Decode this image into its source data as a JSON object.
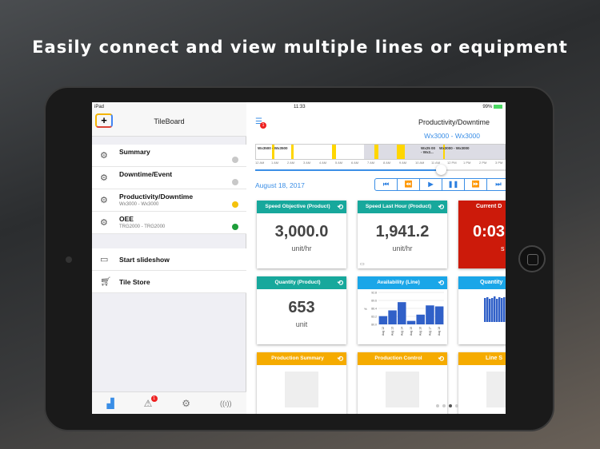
{
  "headline": "Easily connect and view multiple lines or equipment",
  "status": {
    "device": "iPad",
    "time": "11:33",
    "battery": "99%"
  },
  "sidebar": {
    "title": "TileBoard",
    "items": [
      {
        "label": "Summary",
        "sub": "",
        "status_color": "#c8c8c8"
      },
      {
        "label": "Downtime/Event",
        "sub": "",
        "status_color": "#c8c8c8"
      },
      {
        "label": "Productivity/Downtime",
        "sub": "Wx3000 - Wx3000",
        "status_color": "#f4c20d"
      },
      {
        "label": "OEE",
        "sub": "TRG2000 - TRG2000",
        "status_color": "#1e9e3a"
      }
    ],
    "actions": [
      {
        "label": "Start slideshow",
        "icon": "slideshow-icon"
      },
      {
        "label": "Tile Store",
        "icon": "cart-icon"
      }
    ],
    "tabs": [
      {
        "icon": "factory-icon",
        "active": true
      },
      {
        "icon": "alert-icon",
        "badge": "1"
      },
      {
        "icon": "gear-icon"
      },
      {
        "icon": "antenna-icon"
      }
    ]
  },
  "main": {
    "menu_badge": "1",
    "title": "Productivity/Downtime",
    "subtitle": "Wx3000 - Wx3000",
    "timeline": {
      "segments": [
        "Wx3500 - Wx3500",
        "Wx25 00 - Wx2...",
        "Wx3000 - Wx3000"
      ],
      "ticks": [
        "12 AM",
        "1 AM",
        "2 AM",
        "3 AM",
        "4 AM",
        "5 AM",
        "6 AM",
        "7 AM",
        "8 AM",
        "9 AM",
        "10 AM",
        "11 AM",
        "12 PM",
        "1 PM",
        "2 PM",
        "3 PM"
      ],
      "position": 0.74
    },
    "date": "August 18, 2017",
    "tiles": [
      {
        "title": "Speed Objective (Product)",
        "value": "3,000.0",
        "unit": "unit/hr"
      },
      {
        "title": "Speed Last Hour (Product)",
        "value": "1,941.2",
        "unit": "unit/hr"
      },
      {
        "title": "Current D",
        "value": "0:03",
        "unit": "s"
      },
      {
        "title": "Quantity (Product)",
        "value": "653",
        "unit": "unit"
      },
      {
        "title": "Availability (Line)"
      },
      {
        "title": "Quantity"
      },
      {
        "title": "Production Summary"
      },
      {
        "title": "Production Control"
      },
      {
        "title": "Line S"
      }
    ]
  },
  "chart_data": {
    "type": "bar",
    "title": "Availability (Line)",
    "ylabel": "%",
    "categories": [
      "Aug 12",
      "Aug 13",
      "Aug 14",
      "Aug 15",
      "Aug 16",
      "Aug 17",
      "Aug 18"
    ],
    "values": [
      83.3,
      85.6,
      88.9,
      81.4,
      83.9,
      87.6,
      87.2
    ],
    "ylim": [
      80.0,
      92.8
    ],
    "yticks": [
      "80.0",
      "83.2",
      "86.4",
      "89.6",
      "92.8"
    ],
    "color": "#3060c8"
  }
}
